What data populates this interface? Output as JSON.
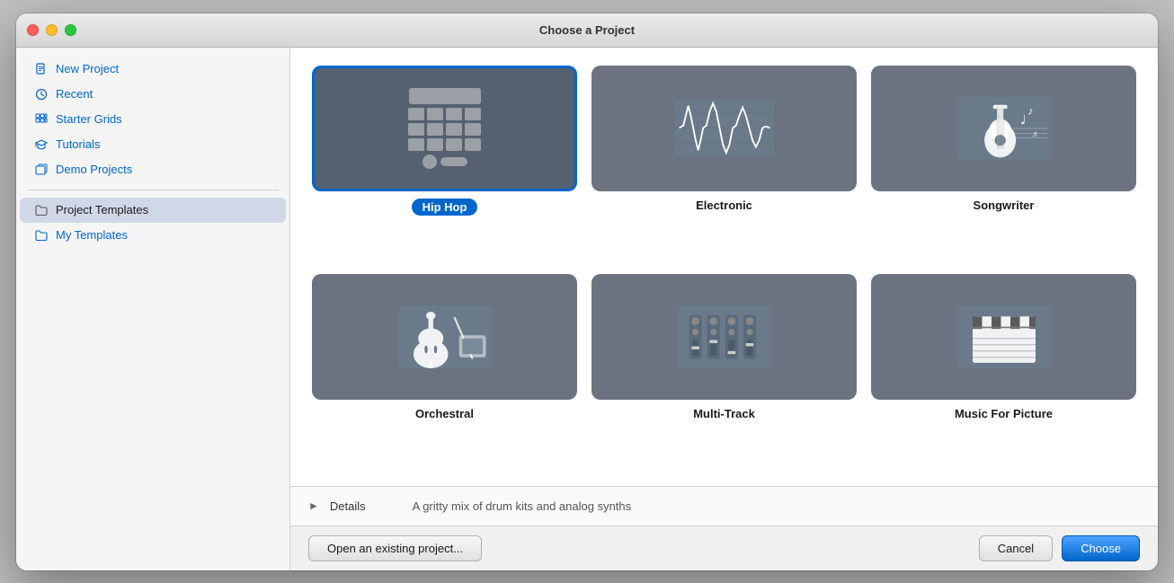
{
  "window": {
    "title": "Choose a Project"
  },
  "sidebar": {
    "items": [
      {
        "id": "new-project",
        "label": "New Project",
        "icon": "📄"
      },
      {
        "id": "recent",
        "label": "Recent",
        "icon": "🕐"
      },
      {
        "id": "starter-grids",
        "label": "Starter Grids",
        "icon": "⊞"
      },
      {
        "id": "tutorials",
        "label": "Tutorials",
        "icon": "🎓"
      },
      {
        "id": "demo-projects",
        "label": "Demo Projects",
        "icon": "📋"
      },
      {
        "id": "project-templates",
        "label": "Project Templates",
        "icon": "📁",
        "active": true
      },
      {
        "id": "my-templates",
        "label": "My Templates",
        "icon": "📁"
      }
    ]
  },
  "templates": [
    {
      "id": "hip-hop",
      "label": "Hip Hop",
      "selected": true
    },
    {
      "id": "electronic",
      "label": "Electronic",
      "selected": false
    },
    {
      "id": "songwriter",
      "label": "Songwriter",
      "selected": false
    },
    {
      "id": "orchestral",
      "label": "Orchestral",
      "selected": false
    },
    {
      "id": "multi-track",
      "label": "Multi-Track",
      "selected": false
    },
    {
      "id": "music-for-picture",
      "label": "Music For Picture",
      "selected": false
    }
  ],
  "details": {
    "label": "Details",
    "description": "A gritty mix of drum kits and analog synths"
  },
  "footer": {
    "open_existing_label": "Open an existing project...",
    "cancel_label": "Cancel",
    "choose_label": "Choose"
  }
}
